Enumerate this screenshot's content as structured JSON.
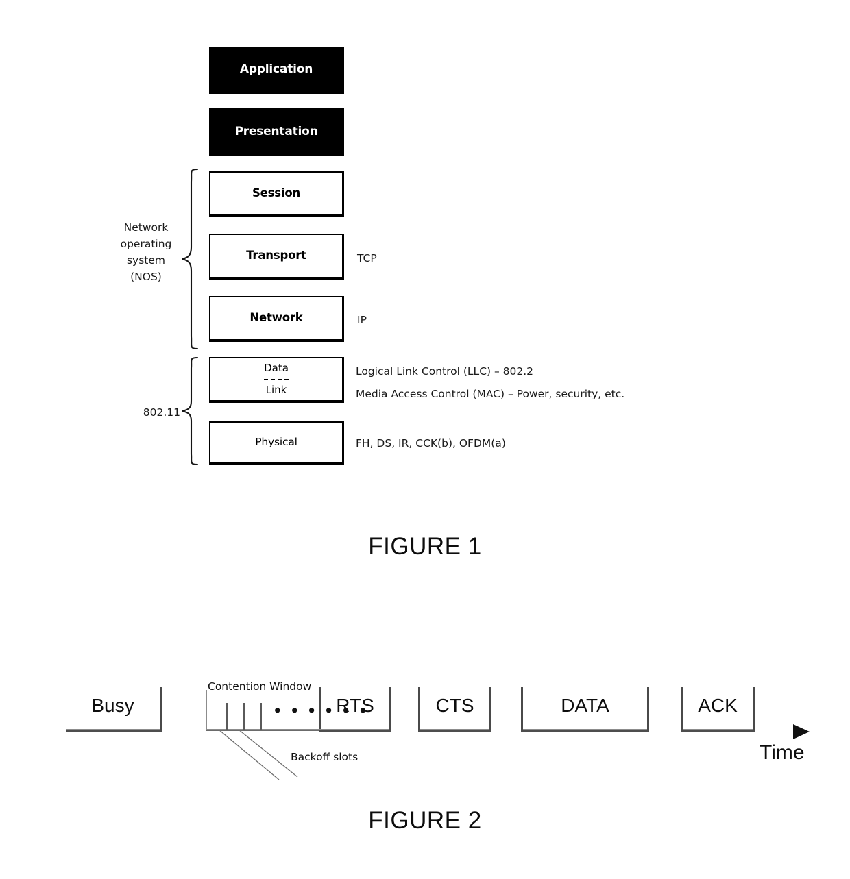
{
  "figure1": {
    "caption": "FIGURE 1",
    "layers": [
      {
        "name": "Application",
        "style": "dark",
        "annotation": ""
      },
      {
        "name": "Presentation",
        "style": "dark",
        "annotation": ""
      },
      {
        "name": "Session",
        "style": "light",
        "annotation": ""
      },
      {
        "name": "Transport",
        "style": "light",
        "annotation": "TCP"
      },
      {
        "name": "Network",
        "style": "light",
        "annotation": "IP"
      }
    ],
    "data_link": {
      "top_label": "Data",
      "bottom_label": "Link",
      "annotation_top": "Logical Link Control (LLC) – 802.2",
      "annotation_bottom": "Media Access Control (MAC) – Power, security, etc."
    },
    "physical": {
      "name": "Physical",
      "annotation": "FH, DS, IR, CCK(b), OFDM(a)"
    },
    "braces": [
      {
        "id": "nos",
        "label": "Network\noperating\nsystem\n(NOS)",
        "lines": [
          "Network",
          "operating",
          "system",
          "(NOS)"
        ]
      },
      {
        "id": "80211",
        "label": "802.11",
        "lines": [
          "802.11"
        ]
      }
    ]
  },
  "figure2": {
    "caption": "FIGURE 2",
    "segments": [
      {
        "id": "busy",
        "label": "Busy"
      },
      {
        "id": "contention",
        "label": ""
      },
      {
        "id": "rts",
        "label": "RTS"
      },
      {
        "id": "cts",
        "label": "CTS"
      },
      {
        "id": "data",
        "label": "DATA"
      },
      {
        "id": "ack",
        "label": "ACK"
      }
    ],
    "contention_window_label": "Contention Window",
    "backoff_label": "Backoff slots",
    "dots": "• • • • • •",
    "axis_label": "Time"
  },
  "colors": {
    "ink": "#000000",
    "dark_box": "#000000",
    "light_box": "#ffffff",
    "baseline": "#4d4d4d"
  }
}
